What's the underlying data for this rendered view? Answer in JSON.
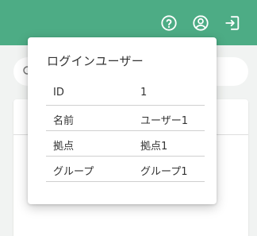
{
  "popover": {
    "title": "ログインユーザー",
    "rows": [
      {
        "key": "ID",
        "value": "1"
      },
      {
        "key": "名前",
        "value": "ユーザー1"
      },
      {
        "key": "拠点",
        "value": "拠点1"
      },
      {
        "key": "グループ",
        "value": "グループ1"
      }
    ]
  },
  "icons": {
    "help": "help-circle-icon",
    "account": "account-circle-icon",
    "logout": "logout-icon",
    "search": "search-icon"
  },
  "colors": {
    "header": "#4dac85",
    "background": "#f1f3f2",
    "card": "#ffffff"
  }
}
